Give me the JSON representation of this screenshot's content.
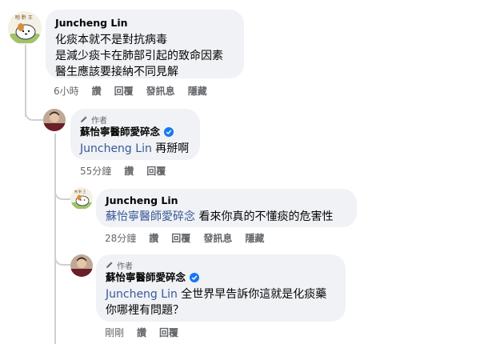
{
  "comments": [
    {
      "author": "Juncheng Lin",
      "is_author": false,
      "lines": [
        "化痰本就不是對抗病毒",
        "是減少痰卡在肺部引起的致命因素",
        "醫生應該要接納不同見解"
      ],
      "time": "6小時",
      "actions": [
        "讚",
        "回覆",
        "發訊息",
        "隱藏"
      ]
    },
    {
      "author_tag": "作者",
      "author": "蘇怡寧醫師愛碎念",
      "verified": true,
      "mention": "Juncheng Lin",
      "text": "再掰啊",
      "time": "55分鐘",
      "actions": [
        "讚",
        "回覆"
      ]
    },
    {
      "author": "Juncheng Lin",
      "mention": "蘇怡寧醫師愛碎念",
      "text": "看來你真的不懂痰的危害性",
      "time": "28分鐘",
      "actions": [
        "讚",
        "回覆",
        "發訊息",
        "隱藏"
      ]
    },
    {
      "author_tag": "作者",
      "author": "蘇怡寧醫師愛碎念",
      "verified": true,
      "mention": "Juncheng Lin",
      "text_line1": "全世界早告訴你這就是化痰藥",
      "text_line2": "你哪裡有問題？",
      "time": "剛剛",
      "actions": [
        "讚",
        "回覆"
      ]
    }
  ],
  "colors": {
    "bubble": "#f0f2f5",
    "mention": "#385898",
    "meta": "#65676b",
    "verified": "#1877f2"
  },
  "icons": {
    "author_tag_icon": "pencil-icon",
    "verified_icon": "verified-badge-icon"
  }
}
